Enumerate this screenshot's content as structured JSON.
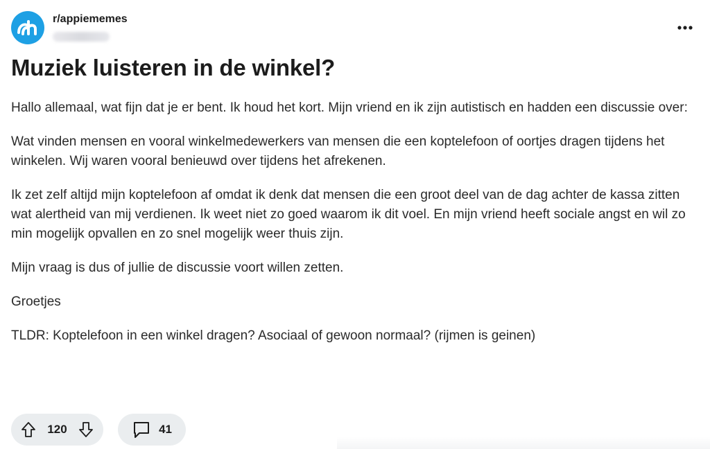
{
  "post": {
    "subreddit": "r/appiememes",
    "title": "Muziek luisteren in de winkel?",
    "paragraphs": [
      "Hallo allemaal, wat fijn dat je er bent. Ik houd het kort. Mijn vriend en ik zijn autistisch en hadden een discussie over:",
      "Wat vinden mensen en vooral winkelmedewerkers van mensen die een koptelefoon of oortjes dragen tijdens het winkelen. Wij waren vooral benieuwd over tijdens het afrekenen.",
      "Ik zet zelf altijd mijn koptelefoon af omdat ik denk dat mensen die een groot deel van de dag achter de kassa zitten wat alertheid van mij verdienen. Ik weet niet zo goed waarom ik dit voel. En mijn vriend heeft sociale angst en wil zo min mogelijk opvallen en zo snel mogelijk weer thuis zijn.",
      "Mijn vraag is dus of jullie de discussie voort willen zetten.",
      "Groetjes",
      "TLDR: Koptelefoon in een winkel dragen? Asociaal of gewoon normaal? (rijmen is geinen)"
    ],
    "vote_count": "120",
    "comment_count": "41"
  },
  "icons": {
    "avatar": "albert-heijn-logo-icon",
    "more": "more-horizontal-icon",
    "upvote": "arrow-up-icon",
    "downvote": "arrow-down-icon",
    "comment": "comment-bubble-icon"
  },
  "colors": {
    "avatar_bg": "#1ea0e4",
    "pill_bg": "#eaedef",
    "text": "#1c1c1c"
  }
}
